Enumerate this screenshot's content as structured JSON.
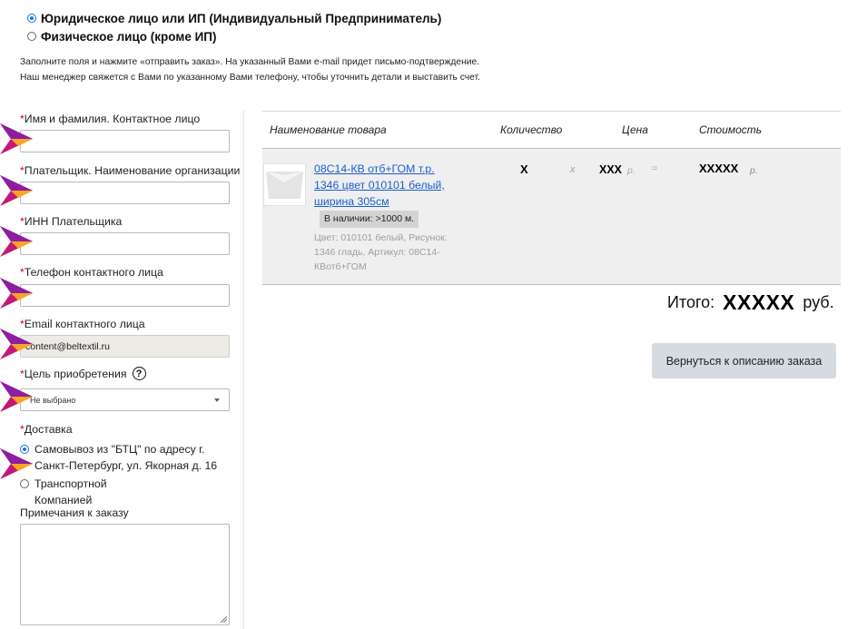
{
  "customer_type": {
    "options": [
      {
        "label": "Юридическое лицо или ИП (Индивидуальный Предприниматель)",
        "selected": true
      },
      {
        "label": "Физическое лицо (кроме ИП)",
        "selected": false
      }
    ]
  },
  "instructions": {
    "line1": "Заполните поля и нажмите «отправить заказ». На указанный Вами e-mail придет письмо-подтверждение.",
    "line2": "Наш менеджер свяжется с Вами по указанному Вами телефону, чтобы уточнить детали и выставить счет."
  },
  "form": {
    "required_mark": "*",
    "name_label": "Имя и фамилия. Контактное лицо",
    "org_label": "Плательщик. Наименование организации",
    "inn_label": "ИНН Плательщика",
    "phone_label": "Телефон контактного лица",
    "email_label": "Email контактного лица",
    "email_value": "content@beltextil.ru",
    "purpose_label": " Цель приобретения",
    "purpose_value": "Не выбрано",
    "help_glyph": "?",
    "delivery_label": "Доставка",
    "delivery_options": [
      {
        "label": "Самовывоз из \"БТЦ\" по адресу г. Санкт-Петербург, ул. Якорная д. 16",
        "selected": true
      },
      {
        "label": "Транспортной Компанией",
        "selected": false
      }
    ],
    "notes_label": "Примечания к заказу"
  },
  "cart": {
    "headers": {
      "name": "Наименование товара",
      "qty": "Количество",
      "price": "Цена",
      "cost": "Стоимость"
    },
    "item": {
      "name": "08С14-КВ отб+ГОМ т.р. 1346 цвет 010101 белый, ширина 305см",
      "stock": "В наличии: >1000 м.",
      "description": "Цвет: 010101 белый, Рисунок: 1346 гладь, Артикул: 08С14-КВотб+ГОМ",
      "qty": "X",
      "mult": "x",
      "price": "XXX",
      "currency_short": "р.",
      "equals": "=",
      "cost": "XXXXX"
    },
    "total_label": "Итого:",
    "total_value": "XXXXX",
    "total_currency": "руб.",
    "back_button": "Вернуться к описанию заказа"
  },
  "colors": {
    "required": "#d0021b",
    "link": "#1a5fd0",
    "button_bg": "#d5dbe0",
    "row_bg": "#efefef"
  }
}
